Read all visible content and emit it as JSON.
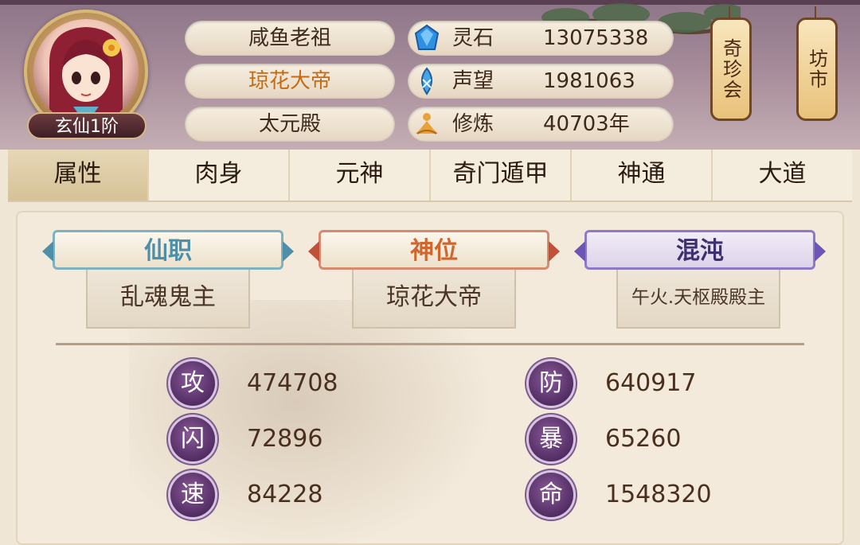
{
  "header": {
    "rank": "玄仙1阶",
    "player_name": "咸鱼老祖",
    "title": "琼花大帝",
    "hall": "太元殿",
    "resources": [
      {
        "icon": "spirit-stone-icon",
        "label": "灵石",
        "value": "13075338"
      },
      {
        "icon": "prestige-icon",
        "label": "声望",
        "value": "1981063"
      },
      {
        "icon": "cultivation-icon",
        "label": "修炼",
        "value": "40703年"
      }
    ],
    "lanterns": [
      {
        "label": "奇珍会"
      },
      {
        "label": "坊市"
      }
    ]
  },
  "tabs": [
    "属性",
    "肉身",
    "元神",
    "奇门遁甲",
    "神通",
    "大道"
  ],
  "active_tab": "属性",
  "ranks": [
    {
      "banner": "仙职",
      "value": "乱魂鬼主",
      "color": "#4d8fa9"
    },
    {
      "banner": "神位",
      "value": "琼花大帝",
      "color": "#d0662e"
    },
    {
      "banner": "混沌",
      "value": "午火.天枢殿殿主",
      "color": "#3d2f70"
    }
  ],
  "stats": [
    {
      "label": "攻",
      "value": "474708"
    },
    {
      "label": "防",
      "value": "640917"
    },
    {
      "label": "闪",
      "value": "72896"
    },
    {
      "label": "暴",
      "value": "65260"
    },
    {
      "label": "速",
      "value": "84228"
    },
    {
      "label": "命",
      "value": "1548320"
    }
  ]
}
